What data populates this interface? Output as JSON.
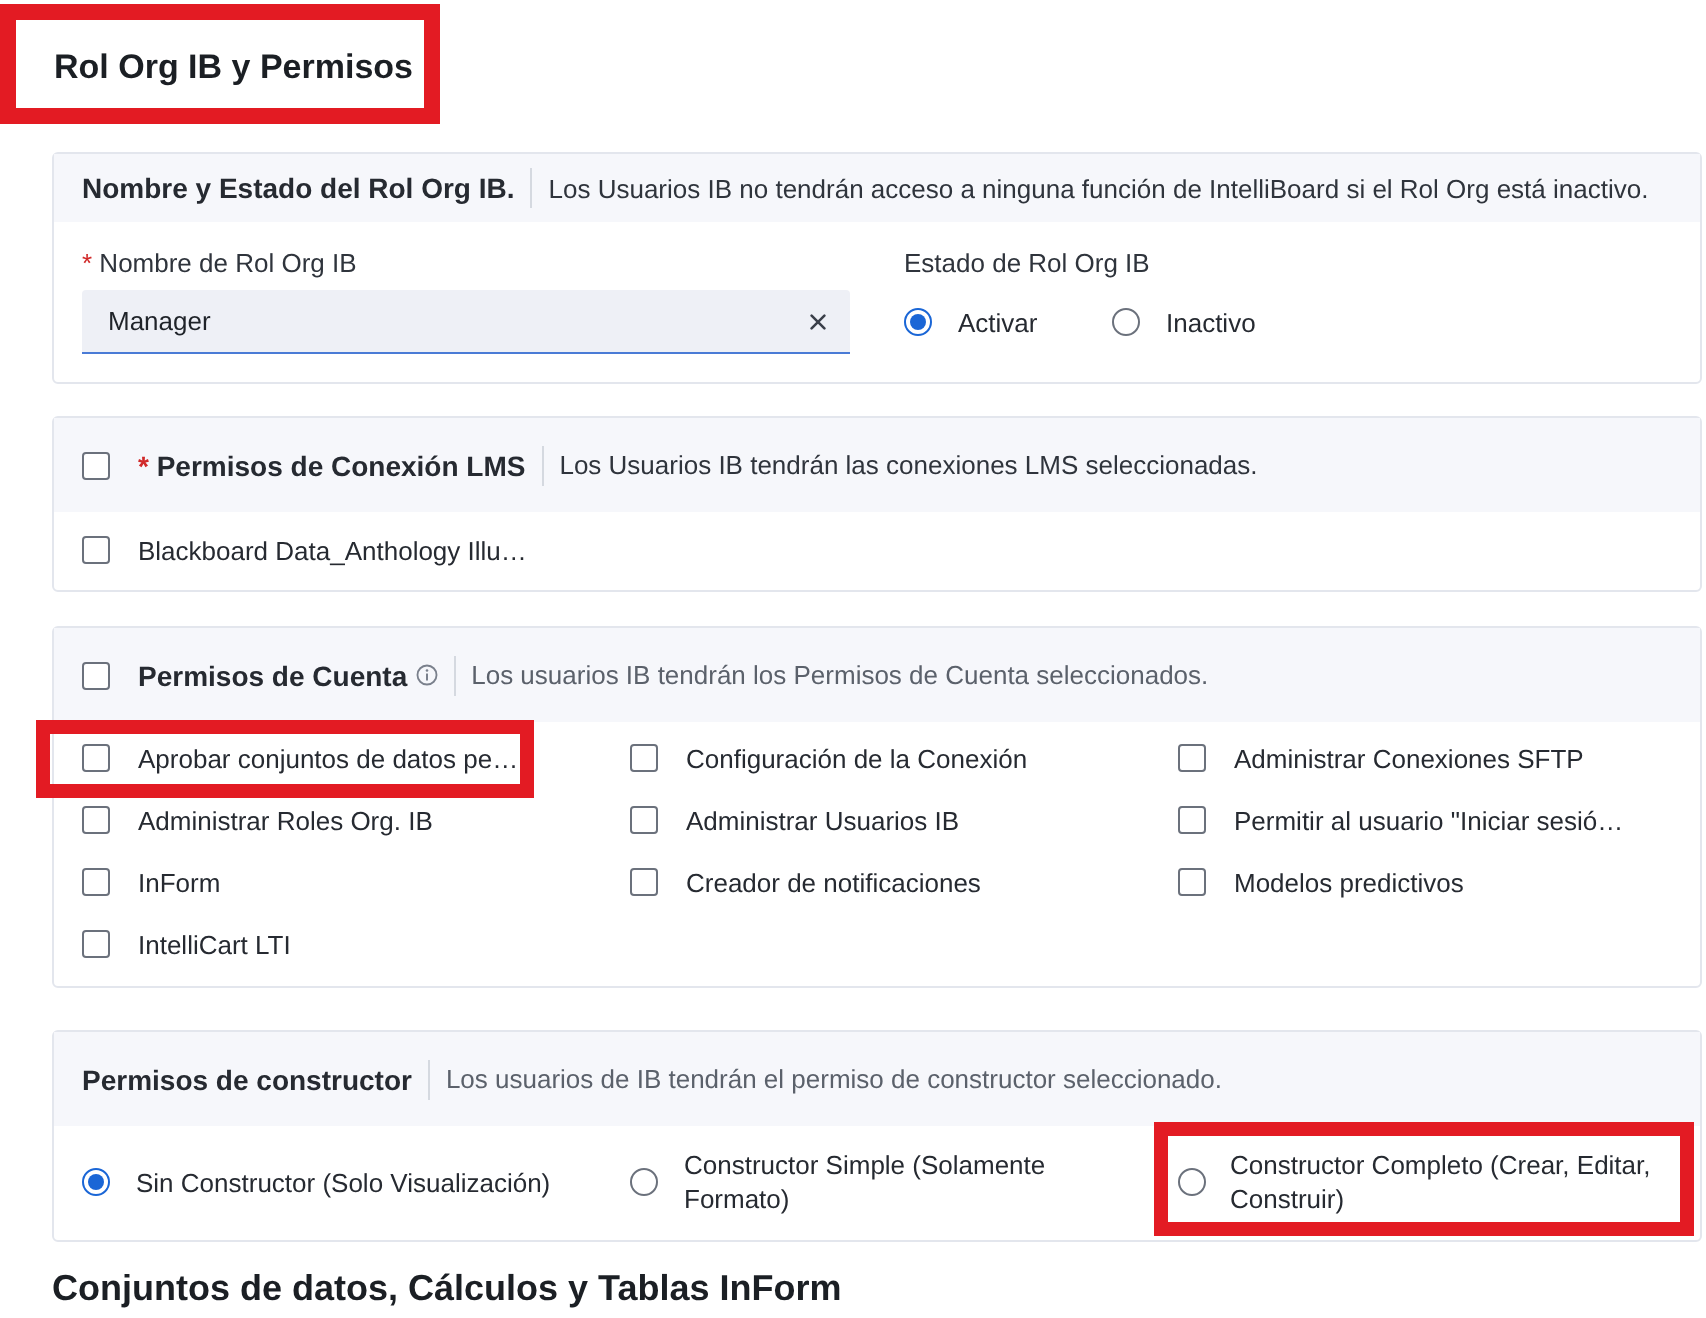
{
  "page": {
    "title": "Rol Org IB y Permisos",
    "highlighted": true
  },
  "role_card": {
    "title": "Nombre y Estado del Rol Org IB.",
    "description": "Los Usuarios IB no tendrán acceso a ninguna función de IntelliBoard si el Rol Org está inactivo.",
    "name_field": {
      "required_mark": "*",
      "label": "Nombre de Rol Org IB",
      "value": "Manager"
    },
    "status": {
      "label": "Estado de Rol Org IB",
      "options": [
        {
          "label": "Activar",
          "selected": true
        },
        {
          "label": "Inactivo",
          "selected": false
        }
      ]
    }
  },
  "lms_card": {
    "checked": false,
    "required_mark": "*",
    "title": "Permisos de Conexión LMS",
    "description": "Los Usuarios IB tendrán las conexiones LMS seleccionadas.",
    "items": [
      {
        "label": "Blackboard Data_Anthology Illu…",
        "checked": false
      }
    ]
  },
  "account_card": {
    "checked": false,
    "title": "Permisos de Cuenta",
    "description": "Los usuarios IB tendrán los Permisos de Cuenta seleccionados.",
    "items": [
      {
        "label": "Aprobar conjuntos de datos pe…",
        "checked": false,
        "highlighted": true
      },
      {
        "label": "Configuración de la Conexión",
        "checked": false,
        "highlighted": false
      },
      {
        "label": "Administrar Conexiones SFTP",
        "checked": false,
        "highlighted": false
      },
      {
        "label": "Administrar Roles Org. IB",
        "checked": false,
        "highlighted": false
      },
      {
        "label": "Administrar Usuarios IB",
        "checked": false,
        "highlighted": false
      },
      {
        "label": "Permitir al usuario \"Iniciar sesió…",
        "checked": false,
        "highlighted": false
      },
      {
        "label": "InForm",
        "checked": false,
        "highlighted": false
      },
      {
        "label": "Creador de notificaciones",
        "checked": false,
        "highlighted": false
      },
      {
        "label": "Modelos predictivos",
        "checked": false,
        "highlighted": false
      },
      {
        "label": "IntelliCart LTI",
        "checked": false,
        "highlighted": false
      }
    ]
  },
  "builder_card": {
    "title": "Permisos de constructor",
    "description": "Los usuarios de IB tendrán el permiso de constructor seleccionado.",
    "options": [
      {
        "label": "Sin Constructor (Solo Visualización)",
        "selected": true,
        "highlighted": false
      },
      {
        "label": "Constructor Simple (Solamente Formato)",
        "selected": false,
        "highlighted": false
      },
      {
        "label": "Constructor Completo (Crear, Editar, Construir)",
        "selected": false,
        "highlighted": true
      }
    ]
  },
  "next_section": {
    "title": "Conjuntos de datos, Cálculos y Tablas InForm"
  }
}
